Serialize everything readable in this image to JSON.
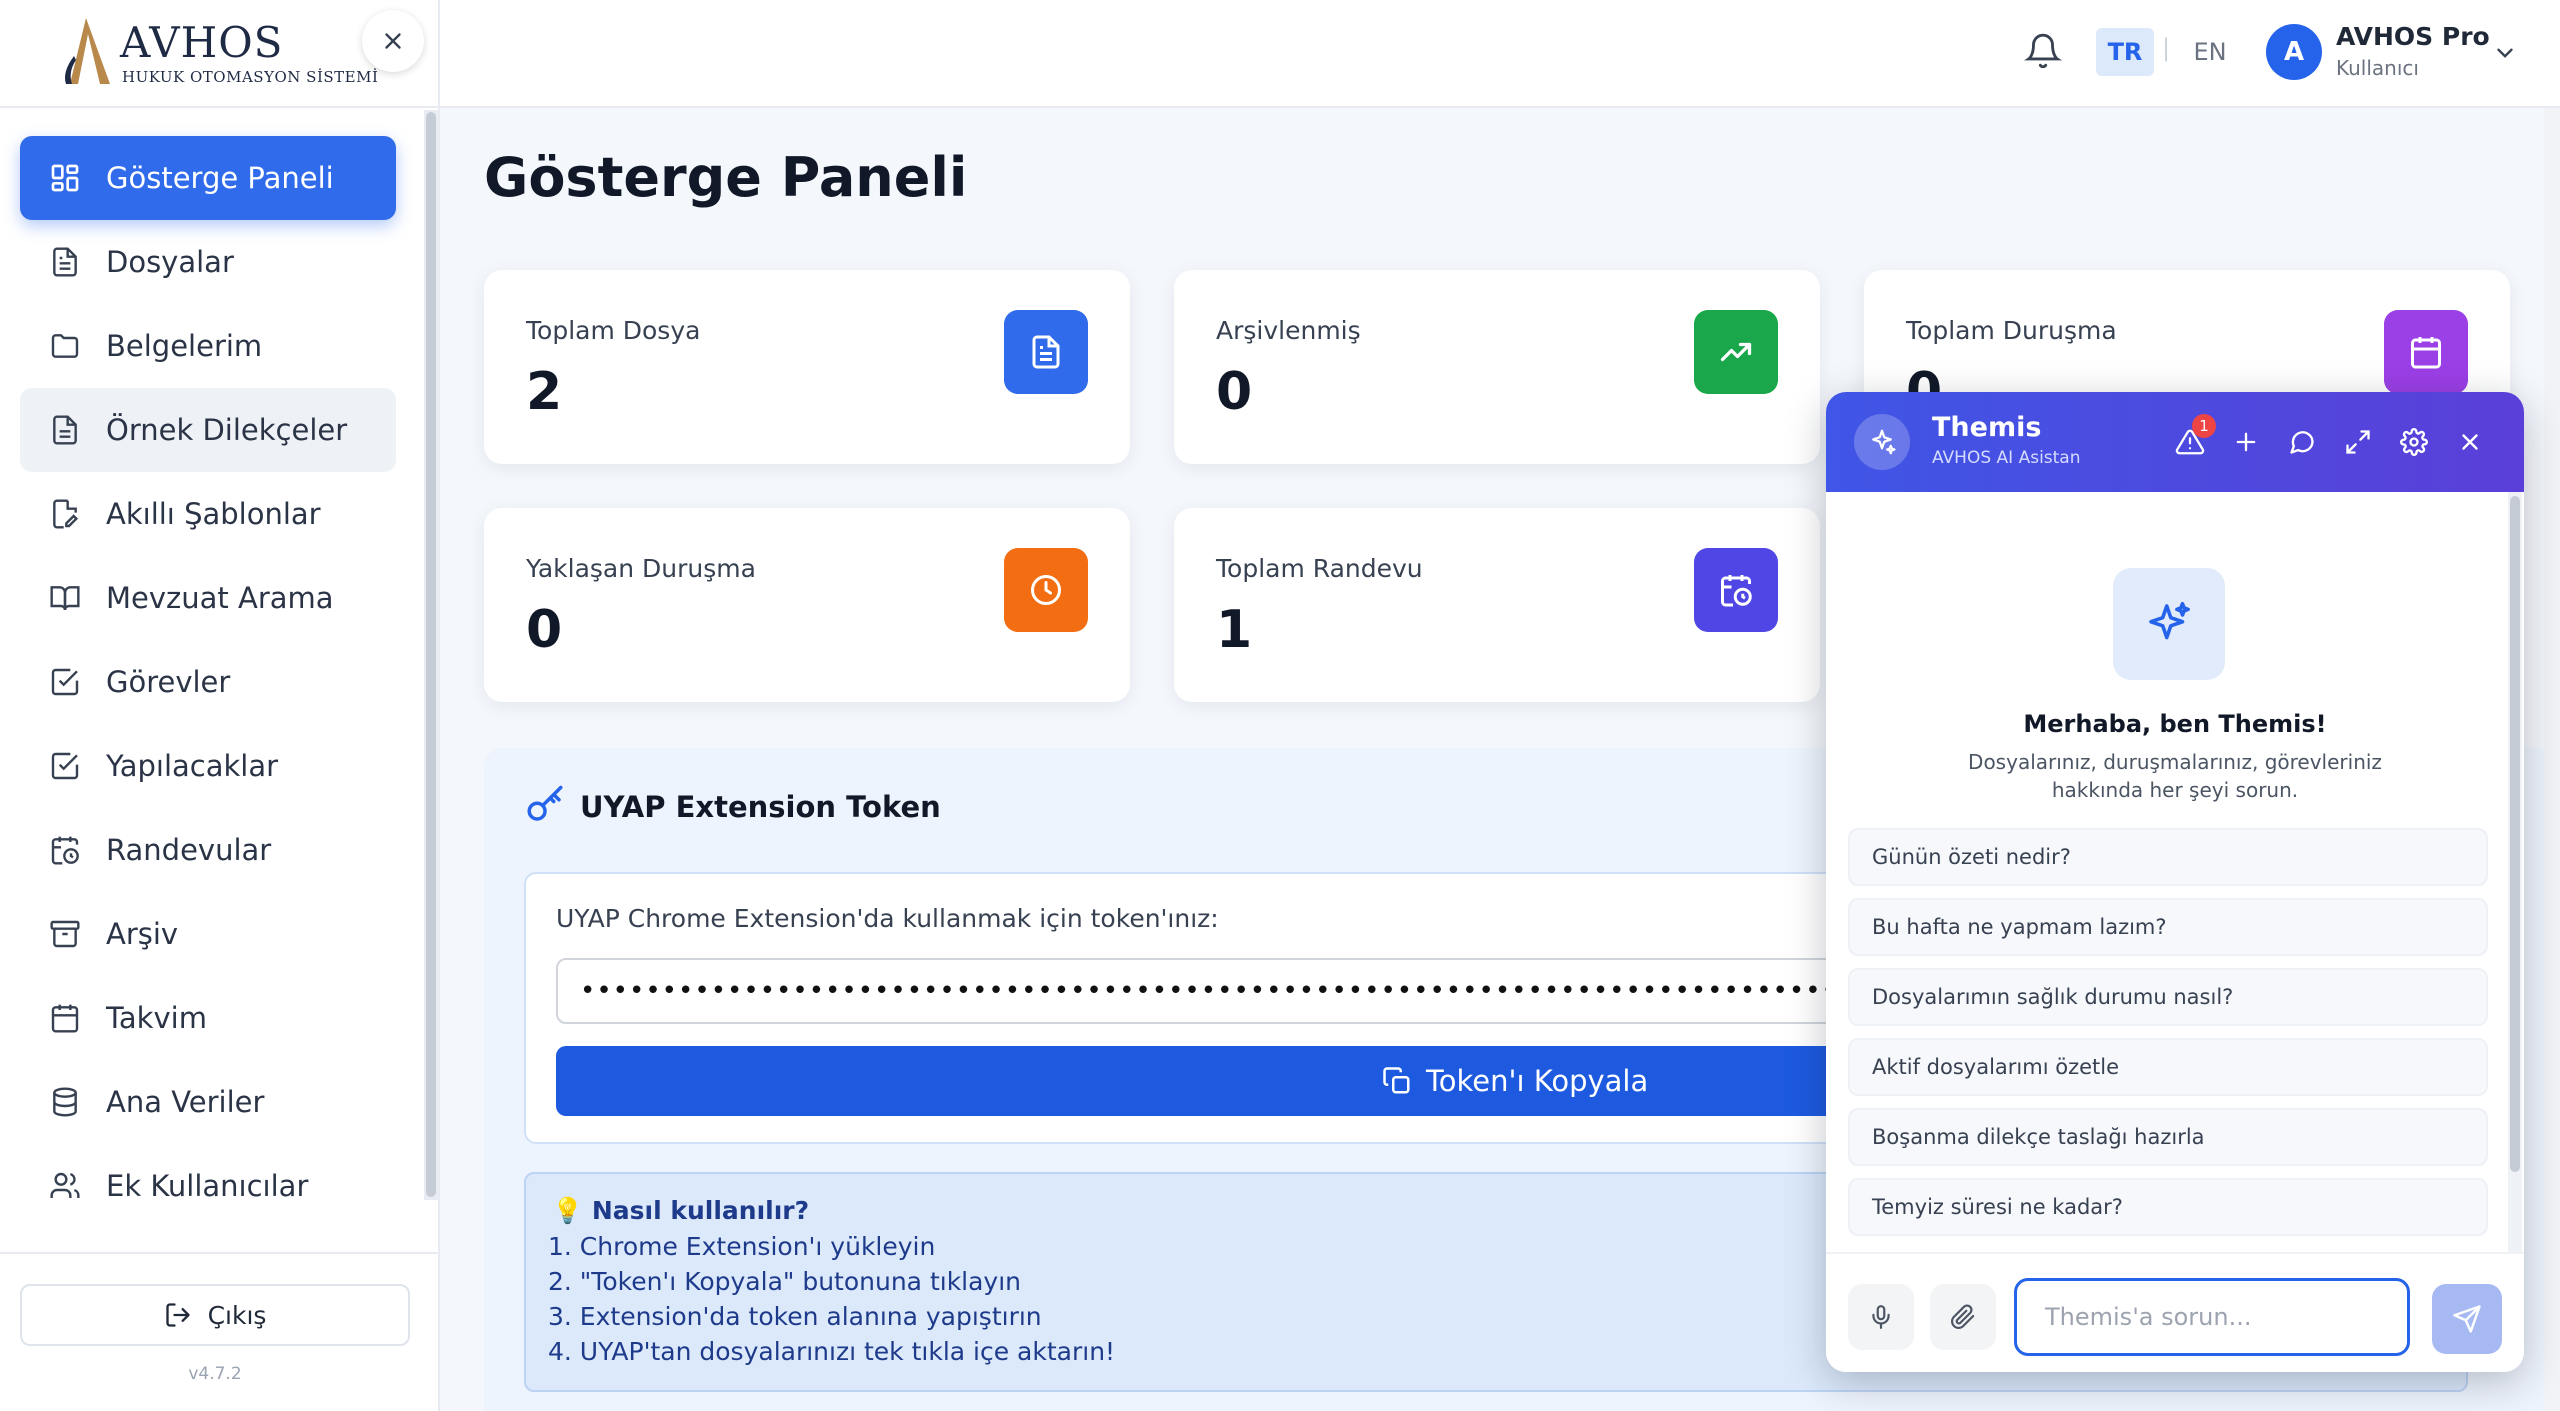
{
  "brand": {
    "name": "AVHOS",
    "subtitle": "HUKUK OTOMASYON SİSTEMİ",
    "version": "v4.7.2"
  },
  "sidebar": {
    "items": [
      {
        "label": "Gösterge Paneli",
        "icon": "dashboard-icon"
      },
      {
        "label": "Dosyalar",
        "icon": "file-icon"
      },
      {
        "label": "Belgelerim",
        "icon": "folder-icon"
      },
      {
        "label": "Örnek Dilekçeler",
        "icon": "document-icon"
      },
      {
        "label": "Akıllı Şablonlar",
        "icon": "file-edit-icon"
      },
      {
        "label": "Mevzuat Arama",
        "icon": "book-icon"
      },
      {
        "label": "Görevler",
        "icon": "checkbox-icon"
      },
      {
        "label": "Yapılacaklar",
        "icon": "checkbox-icon"
      },
      {
        "label": "Randevular",
        "icon": "calendar-clock-icon"
      },
      {
        "label": "Arşiv",
        "icon": "archive-icon"
      },
      {
        "label": "Takvim",
        "icon": "calendar-icon"
      },
      {
        "label": "Ana Veriler",
        "icon": "database-icon"
      },
      {
        "label": "Ek Kullanıcılar",
        "icon": "users-icon"
      }
    ],
    "logout_label": "Çıkış"
  },
  "header": {
    "lang_tr": "TR",
    "lang_sep": "|",
    "lang_en": "EN",
    "avatar_initial": "A",
    "user_name": "AVHOS Pro",
    "user_role": "Kullanıcı"
  },
  "main": {
    "title": "Gösterge Paneli",
    "stats": [
      {
        "label": "Toplam Dosya",
        "value": "2",
        "color": "#2f6bea",
        "icon": "file-icon"
      },
      {
        "label": "Arşivlenmiş",
        "value": "0",
        "color": "#1aa64a",
        "icon": "trending-up-icon"
      },
      {
        "label": "Toplam Duruşma",
        "value": "0",
        "color": "#9b3fe6",
        "icon": "calendar-icon"
      },
      {
        "label": "Yaklaşan Duruşma",
        "value": "0",
        "color": "#f36d12",
        "icon": "clock-icon"
      },
      {
        "label": "Toplam Randevu",
        "value": "1",
        "color": "#4f46e5",
        "icon": "calendar-clock-icon"
      }
    ],
    "token": {
      "title": "UYAP Extension Token",
      "description": "UYAP Chrome Extension'da kullanmak için token'ınız:",
      "value": "••••••••••••••••••••••••••••••••••••••••••••••••••••••••••••••••••••••••••••••••••••••••••••••••••••",
      "copy_label": "Token'ı Kopyala"
    },
    "howto": {
      "title": "💡 Nasıl kullanılır?",
      "steps": [
        "1. Chrome Extension'ı yükleyin",
        "2. \"Token'ı Kopyala\" butonuna tıklayın",
        "3. Extension'da token alanına yapıştırın",
        "4. UYAP'tan dosyalarınızı tek tıkla içe aktarın!"
      ]
    }
  },
  "chat": {
    "name": "Themis",
    "subtitle": "AVHOS AI Asistan",
    "alert_count": "1",
    "greeting": "Merhaba, ben Themis!",
    "intro": "Dosyalarınız, duruşmalarınız, görevleriniz hakkında her şeyi sorun.",
    "suggestions": [
      "Günün özeti nedir?",
      "Bu hafta ne yapmam lazım?",
      "Dosyalarımın sağlık durumu nasıl?",
      "Aktif dosyalarımı özetle",
      "Boşanma dilekçe taslağı hazırla",
      "Temyiz süresi ne kadar?"
    ],
    "input_placeholder": "Themis'a sorun..."
  }
}
